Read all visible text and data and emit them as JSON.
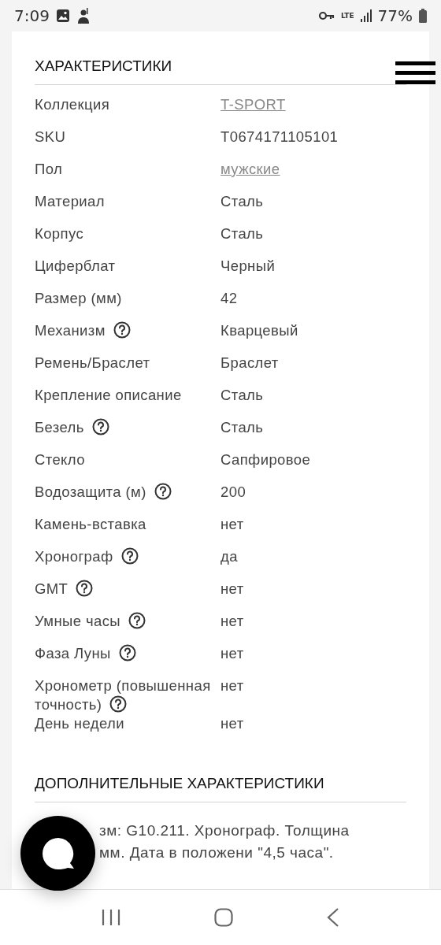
{
  "status_bar": {
    "time": "7:09",
    "network": "LTE",
    "battery": "77%"
  },
  "specs": {
    "title": "ХАРАКТЕРИСТИКИ",
    "rows": [
      {
        "label": "Коллекция",
        "value": "T-SPORT",
        "help": false,
        "link": true
      },
      {
        "label": "SKU",
        "value": "T0674171105101",
        "help": false,
        "link": false
      },
      {
        "label": "Пол",
        "value": "мужские",
        "help": false,
        "link": true
      },
      {
        "label": "Материал",
        "value": "Сталь",
        "help": false,
        "link": false
      },
      {
        "label": "Корпус",
        "value": "Сталь",
        "help": false,
        "link": false
      },
      {
        "label": "Циферблат",
        "value": "Черный",
        "help": false,
        "link": false
      },
      {
        "label": "Размер (мм)",
        "value": "42",
        "help": false,
        "link": false
      },
      {
        "label": "Механизм",
        "value": "Кварцевый",
        "help": true,
        "link": false
      },
      {
        "label": "Ремень/Браслет",
        "value": "Браслет",
        "help": false,
        "link": false
      },
      {
        "label": "Крепление описание",
        "value": "Сталь",
        "help": false,
        "link": false
      },
      {
        "label": "Безель",
        "value": "Сталь",
        "help": true,
        "link": false
      },
      {
        "label": "Стекло",
        "value": "Сапфировое",
        "help": false,
        "link": false
      },
      {
        "label": "Водозащита (м)",
        "value": "200",
        "help": true,
        "link": false
      },
      {
        "label": "Камень-вставка",
        "value": "нет",
        "help": false,
        "link": false
      },
      {
        "label": "Хронограф",
        "value": "да",
        "help": true,
        "link": false
      },
      {
        "label": "GMT",
        "value": "нет",
        "help": true,
        "link": false
      },
      {
        "label": "Умные часы",
        "value": "нет",
        "help": true,
        "link": false
      },
      {
        "label": "Фаза Луны",
        "value": "нет",
        "help": true,
        "link": false
      },
      {
        "label": "Хронометр (повышенная точность)",
        "value": "нет",
        "help": true,
        "link": false
      },
      {
        "label": "День недели",
        "value": "нет",
        "help": false,
        "link": false
      }
    ]
  },
  "extra": {
    "title": "ДОПОЛНИТЕЛЬНЫЕ ХАРАКТЕРИСТИКИ",
    "lines": [
      "зм: G10.211. Хронограф. Толщина",
      "мм. Дата в положени \"4,5 часа\"."
    ]
  }
}
